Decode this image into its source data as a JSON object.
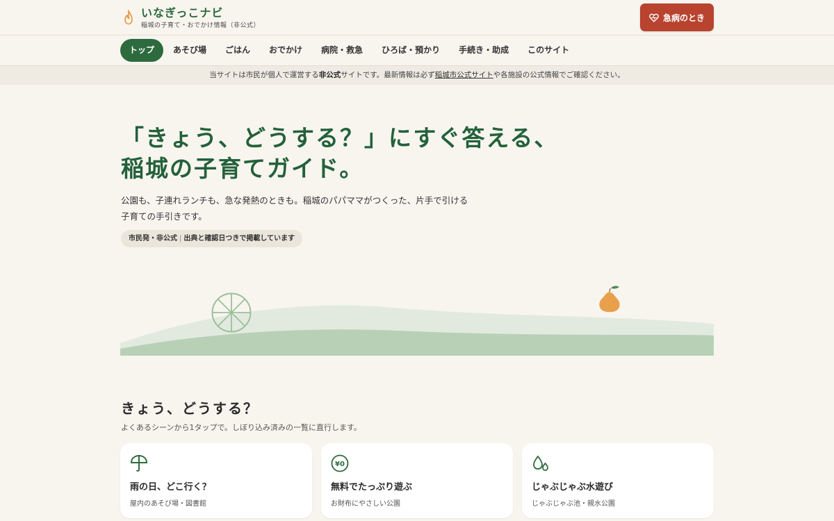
{
  "brand": {
    "title": "いなぎっこナビ",
    "subtitle": "稲城の子育て・おでかけ情報（非公式）",
    "logo_icon": "drop-fire-icon"
  },
  "emergency": {
    "label": "急病のとき",
    "icon": "heart-pulse-icon",
    "color": "#b8432f"
  },
  "nav": {
    "items": [
      {
        "label": "トップ",
        "active": true
      },
      {
        "label": "あそび場"
      },
      {
        "label": "ごはん"
      },
      {
        "label": "おでかけ"
      },
      {
        "label": "病院・救急"
      },
      {
        "label": "ひろば・預かり"
      },
      {
        "label": "手続き・助成"
      },
      {
        "label": "このサイト"
      }
    ]
  },
  "notice": {
    "pre": "当サイトは市民が個人で運営する",
    "bold": "非公式",
    "mid": "サイトです。最新情報は必ず",
    "link": "稲城市公式サイト",
    "post": "や各施設の公式情報でご確認ください。"
  },
  "hero": {
    "title_line1": "「きょう、どうする？」にすぐ答える、",
    "title_line2": "稲城の子育てガイド。",
    "desc": "公園も、子連れランチも、急な発熱のときも。稲城のパパママがつくった、片手で引ける子育ての手引きです。",
    "chip_a": "市民発・非公式",
    "chip_sep": "|",
    "chip_b": "出典と確認日つきで掲載しています"
  },
  "today": {
    "title": "きょう、どうする？",
    "subtitle": "よくあるシーンから1タップで。しぼり込み済みの一覧に直行します。",
    "cards": [
      {
        "title": "雨の日、どこ行く？",
        "sub": "屋内のあそび場・図書館",
        "icon": "umbrella-icon"
      },
      {
        "title": "無料でたっぷり遊ぶ",
        "sub": "お財布にやさしい公園",
        "icon_text": "¥0",
        "icon": "yen-zero-icon"
      },
      {
        "title": "じゃぶじゃぶ水遊び",
        "sub": "じゃぶじゃぶ池・親水公園",
        "icon": "water-drops-icon"
      }
    ]
  },
  "colors": {
    "primary": "#2d6b3e",
    "accent": "#b8432f",
    "background": "#f8f5ef",
    "pear": "#e8a04c"
  }
}
